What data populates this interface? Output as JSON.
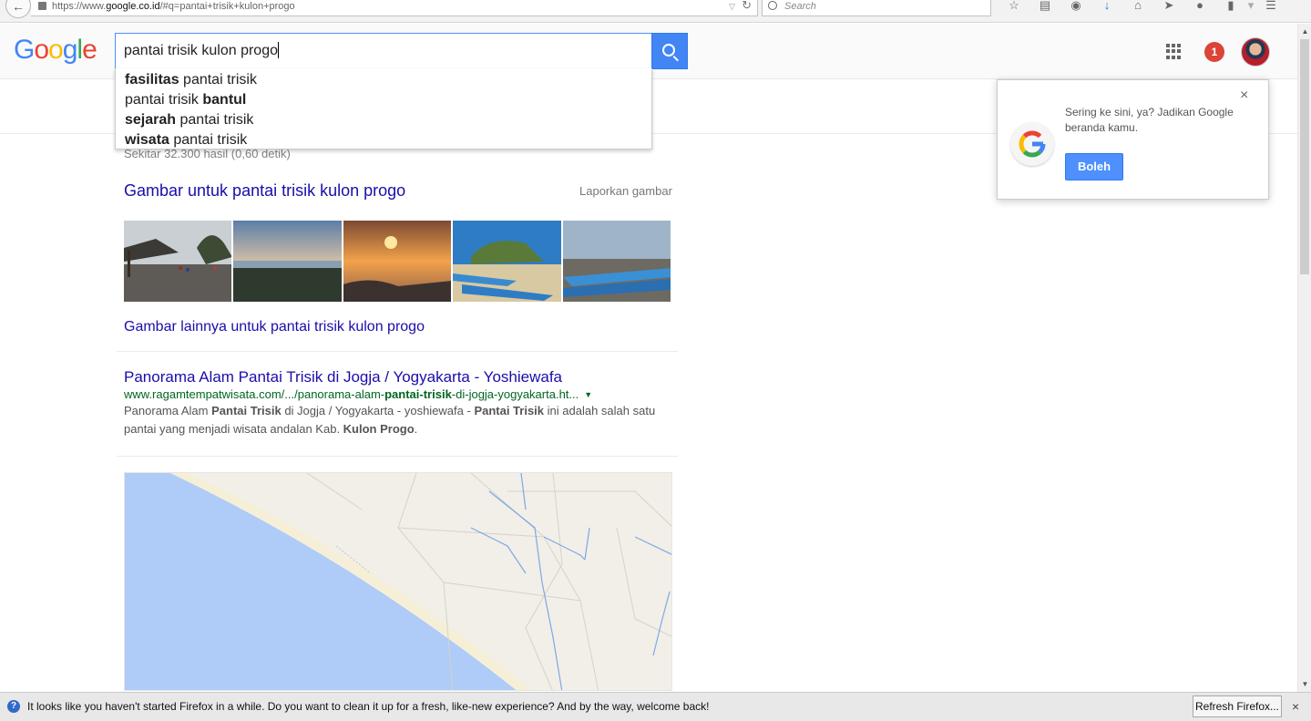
{
  "browser": {
    "url_prefix": "https://www.",
    "url_domain": "google.co.id",
    "url_path": "/#q=pantai+trisik+kulon+progo",
    "search_placeholder": "Search"
  },
  "google": {
    "logo_letters": [
      "G",
      "o",
      "o",
      "g",
      "l",
      "e"
    ],
    "query": "pantai trisik kulon progo",
    "notification_count": "1"
  },
  "suggestions": [
    {
      "bold": "fasilitas",
      "rest": " pantai trisik",
      "bold_first": true
    },
    {
      "bold": "bantul",
      "rest": "pantai trisik ",
      "bold_first": false
    },
    {
      "bold": "sejarah",
      "rest": " pantai trisik",
      "bold_first": true
    },
    {
      "bold": "wisata",
      "rest": " pantai trisik",
      "bold_first": true
    }
  ],
  "results": {
    "stats": "Sekitar 32.300 hasil (0,60 detik)",
    "images_heading": "Gambar untuk pantai trisik kulon progo",
    "report_images": "Laporkan gambar",
    "more_images": "Gambar lainnya untuk pantai trisik kulon progo",
    "first_result": {
      "title": "Panorama Alam Pantai Trisik di Jogja / Yogyakarta - Yoshiewafa",
      "url_pre": "www.ragamtempatwisata.com/.../panorama-alam-",
      "url_bold": "pantai-trisik",
      "url_post": "-di-jogja-yogyakarta.ht...",
      "snippet_parts": [
        {
          "t": "Panorama Alam ",
          "b": false
        },
        {
          "t": "Pantai Trisik",
          "b": true
        },
        {
          "t": " di Jogja / Yogyakarta - yoshiewafa - ",
          "b": false
        },
        {
          "t": "Pantai Trisik",
          "b": true
        },
        {
          "t": " ini adalah salah satu pantai yang menjadi wisata andalan Kab. ",
          "b": false
        },
        {
          "t": "Kulon Progo",
          "b": true
        },
        {
          "t": ".",
          "b": false
        }
      ]
    }
  },
  "homepage_prompt": {
    "text": "Sering ke sini, ya? Jadikan Google beranda kamu.",
    "button": "Boleh",
    "close": "×"
  },
  "notification_bar": {
    "text": "It looks like you haven't started Firefox in a while. Do you want to clean it up for a fresh, like-new experience? And by the way, welcome back!",
    "button": "Refresh Firefox...",
    "close": "×"
  },
  "colors": {
    "link": "#1a0dab",
    "url_green": "#006621",
    "accent_blue": "#4285f4",
    "badge_red": "#db4437"
  }
}
